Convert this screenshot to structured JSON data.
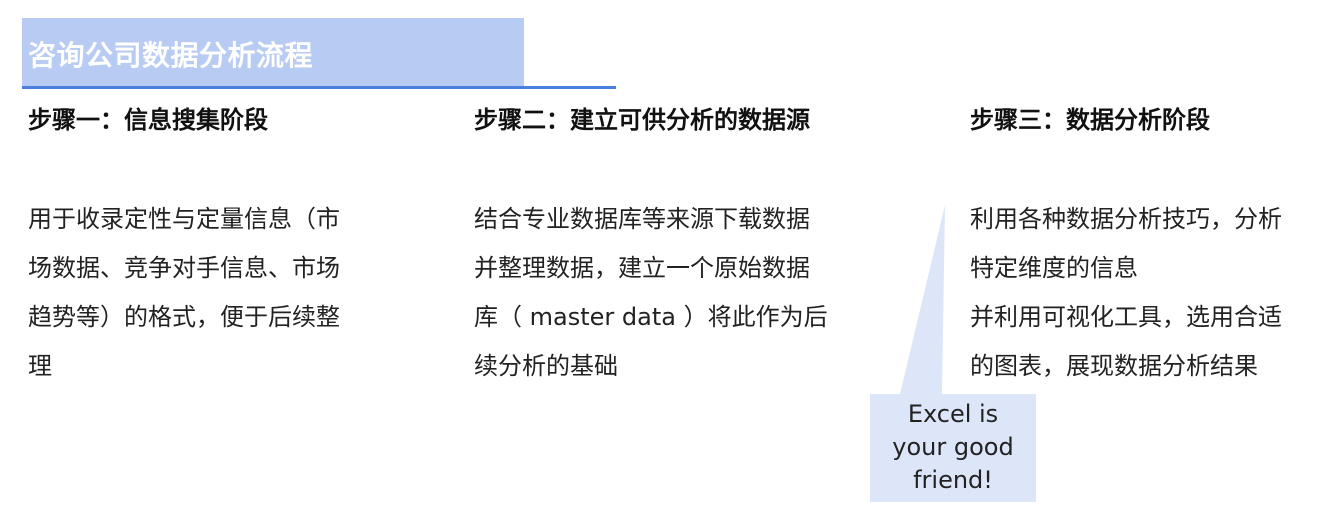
{
  "header": {
    "title": "咨询公司数据分析流程"
  },
  "steps": [
    {
      "heading": "步骤一：信息搜集阶段",
      "lines": [
        "用于收录定性与定量信息（市",
        "场数据、竞争对手信息、市场",
        "趋势等）的格式，便于后续整",
        "理"
      ]
    },
    {
      "heading": "步骤二：建立可供分析的数据源",
      "lines": [
        "结合专业数据库等来源下载数据",
        "并整理数据，建立一个原始数据",
        "库（ master data ）将此作为后",
        "续分析的基础"
      ]
    },
    {
      "heading": "步骤三：数据分析阶段",
      "lines": [
        "利用各种数据分析技巧，分析",
        "特定维度的信息",
        "并利用可视化工具，选用合适",
        "的图表，展现数据分析结果"
      ]
    }
  ],
  "callout": {
    "lines": [
      "Excel is",
      "your good",
      "friend!"
    ]
  },
  "colors": {
    "title_bar": "#b8cbf3",
    "underline": "#4a7fe0",
    "callout_fill": "#dde6f9"
  }
}
